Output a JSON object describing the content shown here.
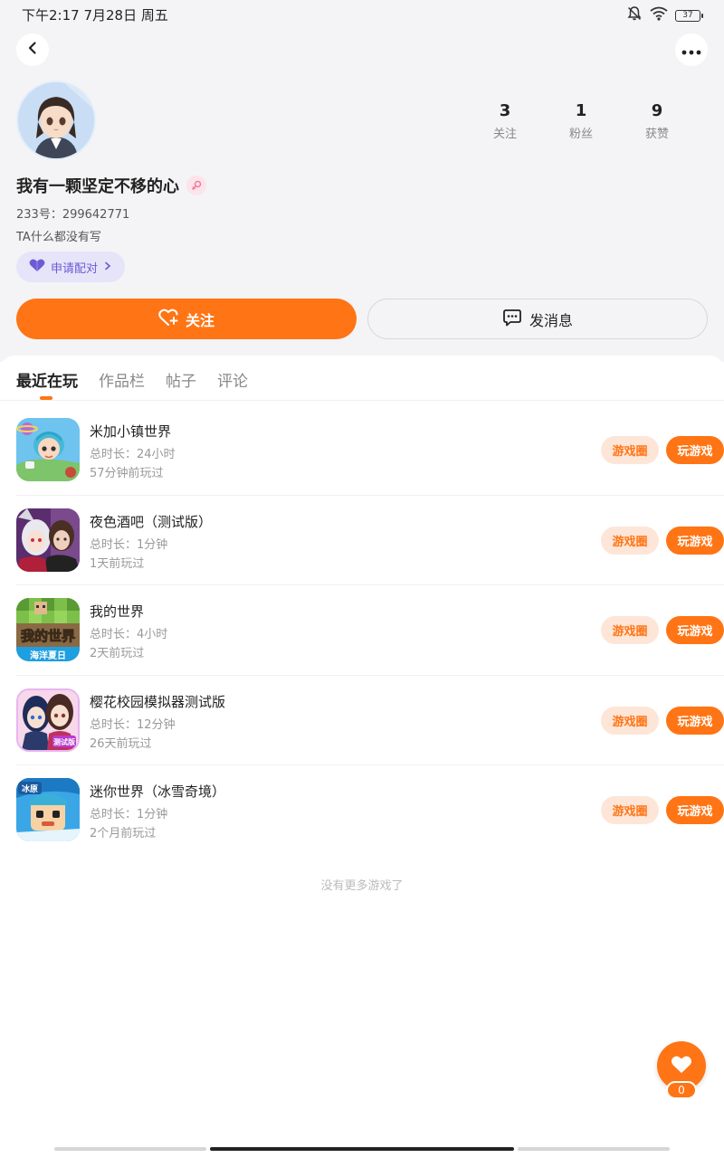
{
  "status_bar": {
    "time": "下午2:17 7月28日 周五",
    "battery": "37"
  },
  "profile": {
    "nickname": "我有一颗坚定不移的心",
    "user_id": "233号：299642771",
    "bio": "TA什么都没有写",
    "pair_label": "申请配对",
    "stats": [
      {
        "num": "3",
        "label": "关注"
      },
      {
        "num": "1",
        "label": "粉丝"
      },
      {
        "num": "9",
        "label": "获赞"
      }
    ],
    "follow_label": "关注",
    "message_label": "发消息"
  },
  "tabs": [
    "最近在玩",
    "作品栏",
    "帖子",
    "评论"
  ],
  "games": [
    {
      "name": "米加小镇世界",
      "duration": "总时长：24小时",
      "last": "57分钟前玩过"
    },
    {
      "name": "夜色酒吧（测试版）",
      "duration": "总时长：1分钟",
      "last": "1天前玩过"
    },
    {
      "name": "我的世界",
      "duration": "总时长：4小时",
      "last": "2天前玩过"
    },
    {
      "name": "樱花校园模拟器测试版",
      "duration": "总时长：12分钟",
      "last": "26天前玩过"
    },
    {
      "name": "迷你世界（冰雪奇境）",
      "duration": "总时长：1分钟",
      "last": "2个月前玩过"
    }
  ],
  "game_buttons": {
    "circle": "游戏圈",
    "play": "玩游戏"
  },
  "game_icon_texts": {
    "mc_title": "我的世界",
    "mc_sub": "海洋夏日",
    "sakura_tag": "测试版",
    "mini_tag": "冰原"
  },
  "no_more": "没有更多游戏了",
  "like_count": "0",
  "colors": {
    "accent": "#ff7414",
    "accent_light": "#fde6d8",
    "pair": "#6b5bd6"
  },
  "icons": [
    "back-icon",
    "more-icon",
    "mute-icon",
    "wifi-icon",
    "battery-icon",
    "female-icon",
    "heart-pair-icon",
    "chevron-right-icon",
    "follow-heart-icon",
    "message-icon",
    "like-heart-icon"
  ]
}
